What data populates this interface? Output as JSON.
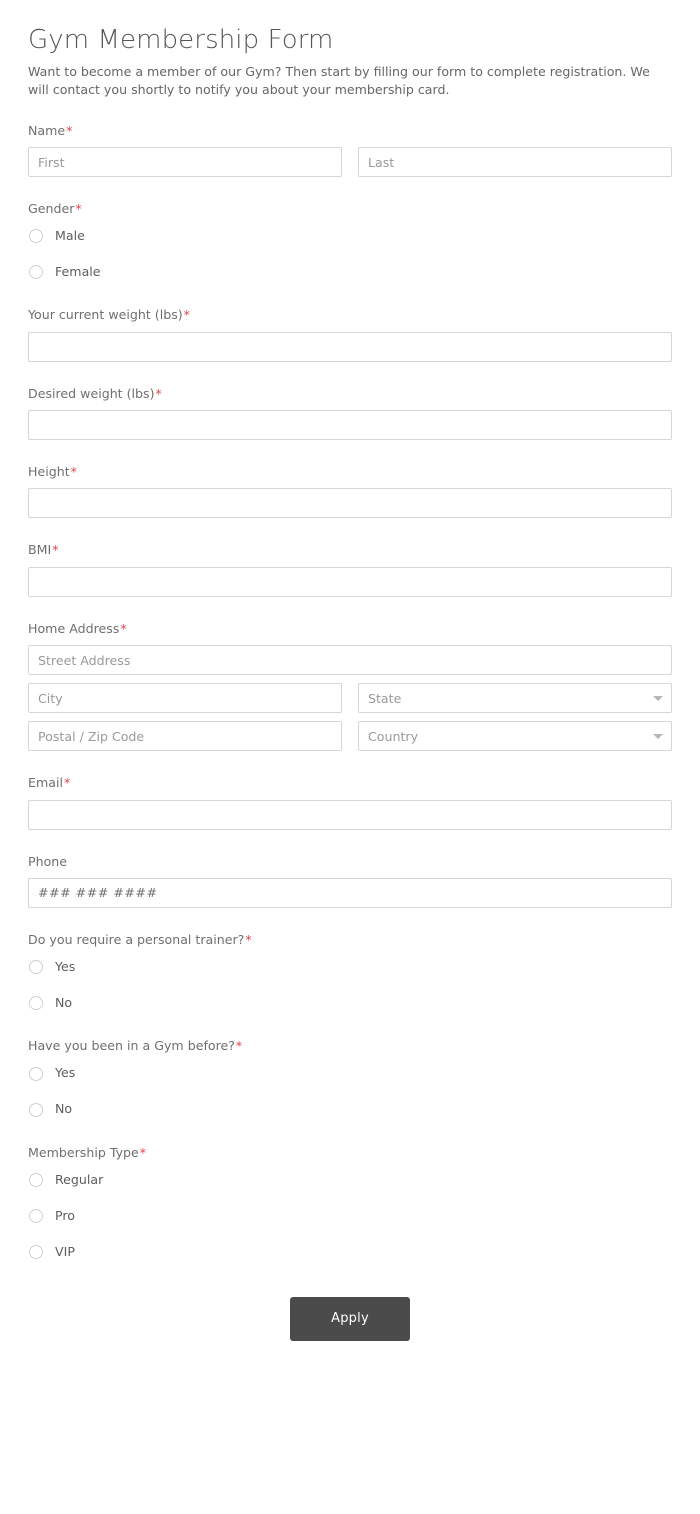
{
  "header": {
    "title": "Gym Membership Form",
    "description": "Want to become a member of our Gym? Then start by filling our form to complete registration. We will contact you shortly to notify you about your membership card."
  },
  "fields": {
    "name": {
      "label": "Name",
      "required": "*",
      "first_placeholder": "First",
      "first_value": "",
      "last_placeholder": "Last",
      "last_value": ""
    },
    "gender": {
      "label": "Gender",
      "required": "*",
      "options": [
        {
          "label": "Male",
          "selected": false
        },
        {
          "label": "Female",
          "selected": false
        }
      ]
    },
    "current_weight": {
      "label": "Your current weight (lbs)",
      "required": "*",
      "placeholder": "",
      "value": ""
    },
    "desired_weight": {
      "label": "Desired weight (lbs)",
      "required": "*",
      "placeholder": "",
      "value": ""
    },
    "height": {
      "label": "Height",
      "required": "*",
      "placeholder": "",
      "value": ""
    },
    "bmi": {
      "label": "BMI",
      "required": "*",
      "placeholder": "",
      "value": ""
    },
    "home_address": {
      "label": "Home Address",
      "required": "*",
      "street_placeholder": "Street Address",
      "street_value": "",
      "city_placeholder": "City",
      "city_value": "",
      "state_placeholder": "State",
      "state_value": "",
      "postal_placeholder": "Postal / Zip Code",
      "postal_value": "",
      "country_placeholder": "Country",
      "country_value": ""
    },
    "email": {
      "label": "Email",
      "required": "*",
      "placeholder": "",
      "value": ""
    },
    "phone": {
      "label": "Phone",
      "required": "",
      "placeholder": "### ### ####",
      "value": ""
    },
    "personal_trainer": {
      "label": "Do you require a personal trainer?",
      "required": "*",
      "options": [
        {
          "label": "Yes",
          "selected": false
        },
        {
          "label": "No",
          "selected": false
        }
      ]
    },
    "gym_before": {
      "label": "Have you been in a Gym before?",
      "required": "*",
      "options": [
        {
          "label": "Yes",
          "selected": false
        },
        {
          "label": "No",
          "selected": false
        }
      ]
    },
    "membership_type": {
      "label": "Membership Type",
      "required": "*",
      "options": [
        {
          "label": "Regular",
          "selected": false
        },
        {
          "label": "Pro",
          "selected": false
        },
        {
          "label": "VIP",
          "selected": false
        }
      ]
    }
  },
  "submit": {
    "label": "Apply"
  },
  "colors": {
    "accent_required": "#e2454a",
    "button_bg": "#4b4b4b",
    "label_text": "#6f6f6f",
    "input_border": "#d6d6d6",
    "title_text": "#555555"
  },
  "icons": {
    "state_dropdown": "chevron-down-icon",
    "country_dropdown": "chevron-down-icon"
  }
}
